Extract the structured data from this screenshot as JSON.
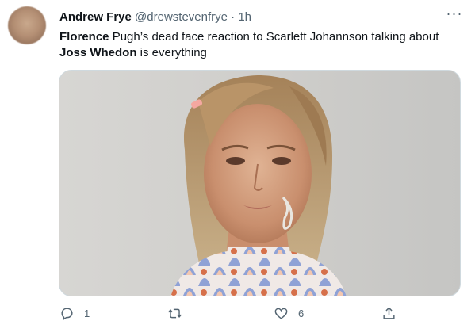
{
  "tweet": {
    "author_name": "Andrew Frye",
    "handle": "@drewstevenfrye",
    "separator": "·",
    "time": "1h",
    "text_parts": [
      {
        "text": "Florence",
        "bold": true
      },
      {
        "text": " Pugh’s dead face reaction to Scarlett Johannson talking about ",
        "bold": false
      },
      {
        "text": "Joss Whedon",
        "bold": true
      },
      {
        "text": " is everything",
        "bold": false
      }
    ],
    "more_label": "···"
  },
  "actions": {
    "reply_count": "1",
    "retweet_count": "",
    "like_count": "6"
  },
  "icons": {
    "more": "more-horizontal-icon",
    "reply": "reply-icon",
    "retweet": "retweet-icon",
    "like": "heart-icon",
    "share": "share-icon"
  },
  "colors": {
    "text": "#0f1419",
    "secondary": "#536471",
    "border": "#cfd9de"
  }
}
